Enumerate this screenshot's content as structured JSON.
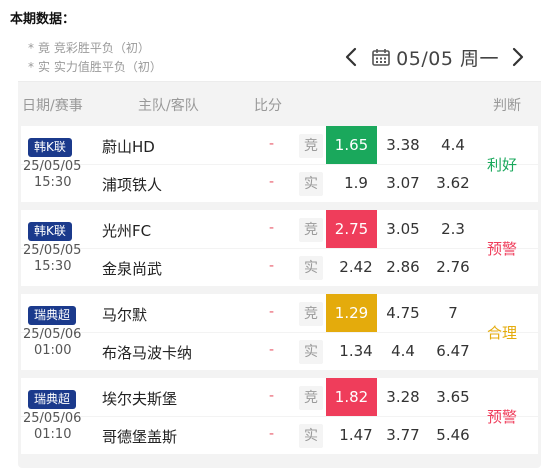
{
  "page": {
    "title": "本期数据："
  },
  "legend": {
    "star": "*",
    "jing_tag": "竟",
    "jing_text": "竞彩胜平负（初）",
    "shi_tag": "实",
    "shi_text": "实力值胜平负（初）"
  },
  "date_nav": {
    "date": "05/05",
    "weekday": "周一"
  },
  "columns": {
    "date_league": "日期/赛事",
    "teams": "主队/客队",
    "score": "比分",
    "judgement": "判断"
  },
  "colors": {
    "green": "#1aa85c",
    "red": "#ef3d5b",
    "yellow": "#e4ab0c",
    "league_bg": "#1b3a8c"
  },
  "matches": [
    {
      "league": "韩K联",
      "date": "25/05/05",
      "time": "15:30",
      "home": "蔚山HD",
      "away": "浦项铁人",
      "score_home": "-",
      "score_away": "-",
      "type_jing": "竞",
      "type_shi": "实",
      "jing": [
        "1.65",
        "3.38",
        "4.4"
      ],
      "shi": [
        "1.9",
        "3.07",
        "3.62"
      ],
      "highlight": "green",
      "verdict": "利好",
      "verdict_color": "#1aa85c"
    },
    {
      "league": "韩K联",
      "date": "25/05/05",
      "time": "15:30",
      "home": "光州FC",
      "away": "金泉尚武",
      "score_home": "-",
      "score_away": "-",
      "type_jing": "竞",
      "type_shi": "实",
      "jing": [
        "2.75",
        "3.05",
        "2.3"
      ],
      "shi": [
        "2.42",
        "2.86",
        "2.76"
      ],
      "highlight": "red",
      "verdict": "预警",
      "verdict_color": "#ef3d5b"
    },
    {
      "league": "瑞典超",
      "date": "25/05/06",
      "time": "01:00",
      "home": "马尔默",
      "away": "布洛马波卡纳",
      "score_home": "-",
      "score_away": "-",
      "type_jing": "竞",
      "type_shi": "实",
      "jing": [
        "1.29",
        "4.75",
        "7"
      ],
      "shi": [
        "1.34",
        "4.4",
        "6.47"
      ],
      "highlight": "yellow",
      "verdict": "合理",
      "verdict_color": "#e4ab0c"
    },
    {
      "league": "瑞典超",
      "date": "25/05/06",
      "time": "01:10",
      "home": "埃尔夫斯堡",
      "away": "哥德堡盖斯",
      "score_home": "-",
      "score_away": "-",
      "type_jing": "竞",
      "type_shi": "实",
      "jing": [
        "1.82",
        "3.28",
        "3.65"
      ],
      "shi": [
        "1.47",
        "3.77",
        "5.46"
      ],
      "highlight": "red",
      "verdict": "预警",
      "verdict_color": "#ef3d5b"
    }
  ]
}
